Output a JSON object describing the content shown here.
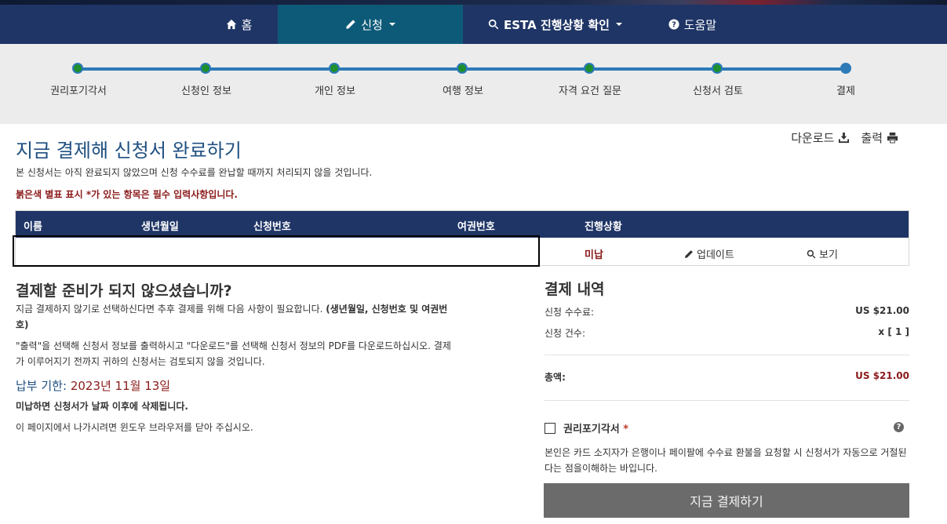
{
  "nav": {
    "items": [
      {
        "label": "홈",
        "icon": "home-icon"
      },
      {
        "label": "신청",
        "icon": "pencil-icon",
        "dropdown": true,
        "active": true
      },
      {
        "label": "ESTA 진행상황 확인",
        "icon": "search-icon",
        "dropdown": true
      },
      {
        "label": "도움말",
        "icon": "question-circle-icon"
      }
    ]
  },
  "progress": {
    "steps": [
      "권리포기각서",
      "신청인 정보",
      "개인 정보",
      "여행 정보",
      "자격 요건 질문",
      "신청서 검토",
      "결제"
    ],
    "current_step": 7
  },
  "page": {
    "title": "지금 결제해 신청서 완료하기",
    "download_label": "다운로드",
    "print_label": "출력",
    "notice": "본 신청서는 아직 완료되지 않았으며 신청 수수료를 완납할 때까지 처리되지 않을 것입니다.",
    "required_note": "붉은색 별표 표시 *가 있는 항목은 필수 입력사항입니다."
  },
  "table": {
    "headers": [
      "이름",
      "생년월일",
      "신청번호",
      "여권번호",
      "진행상황"
    ],
    "row": {
      "status": "미납",
      "update_label": "업데이트",
      "view_label": "보기"
    }
  },
  "left": {
    "heading": "결제할 준비가 되지 않으셨습니까?",
    "para1_text": "지금 결제하지 않기로 선택하신다면 추후 결제를 위해 다음 사항이 필요합니다.",
    "para1_bold": "(생년월일, 신청번호 및 여권번호)",
    "para2": "\"출력\"을 선택해 신청서 정보를 출력하시고 \"다운로드\"를 선택해 신청서 정보의 PDF를 다운로드하십시오. 결제가 이루어지기 전까지 귀하의 신청서는 검토되지 않을 것입니다.",
    "deadline_label": "납부 기한:",
    "deadline_date": "2023년 11월 13일",
    "delete_warning": "미납하면 신청서가 날짜 이후에 삭제됩니다.",
    "leave_note": "이 페이지에서 나가시려면 윈도우 브라우저를 닫아 주십시오."
  },
  "payment": {
    "title": "결제 내역",
    "fee_label": "신청 수수료:",
    "fee_value": "US $21.00",
    "count_label": "신청 건수:",
    "count_value": "x [ 1 ]",
    "total_label": "총액:",
    "total_value": "US $21.00",
    "waiver_label": "권리포기각서",
    "waiver_required": "*",
    "waiver_text": "본인은 카드 소지자가 은행이나 페이팔에 수수료 환불을 요청할 시 신청서가 자동으로 거절된다는 점을이해하는 바입니다.",
    "pay_button": "지금 결제하기"
  },
  "colors": {
    "navbar": "#1f3566",
    "nav_active": "#0d5a78",
    "title_blue": "#1f4f80",
    "alert_red": "#8b1a1a",
    "step_complete": "#1e8f2e",
    "step_line": "#2d7ab8",
    "button_gray": "#6b6b6b"
  }
}
